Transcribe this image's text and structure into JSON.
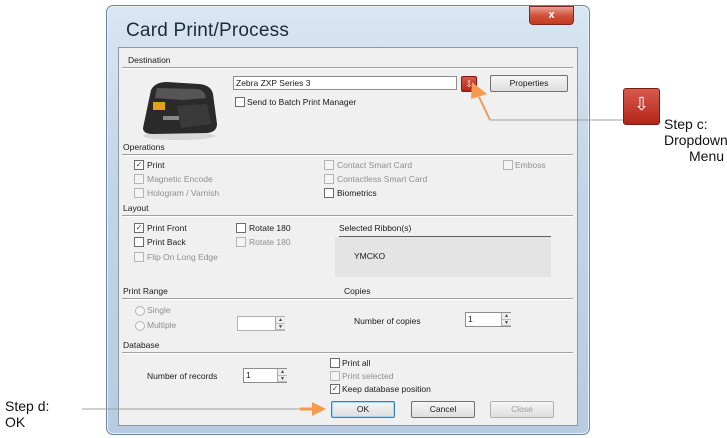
{
  "window": {
    "title": "Card Print/Process",
    "close_glyph": "x"
  },
  "destination": {
    "label": "Destination",
    "printer": "Zebra ZXP Series 3",
    "properties": "Properties",
    "batch": "Send to Batch Print Manager"
  },
  "operations": {
    "label": "Operations",
    "print": "Print",
    "magnetic": "Magnetic Encode",
    "hologram": "Hologram / Varnish",
    "contact": "Contact Smart Card",
    "contactless": "Contactless Smart Card",
    "biometrics": "Biometrics",
    "emboss": "Emboss"
  },
  "layout": {
    "label": "Layout",
    "front": "Print Front",
    "back": "Print Back",
    "flip": "Flip On Long Edge",
    "rotate1": "Rotate 180",
    "rotate2": "Rotate 180",
    "ribbon_header": "Selected Ribbon(s)",
    "ribbon": "YMCKO"
  },
  "range": {
    "label": "Print Range",
    "single": "Single",
    "multiple": "Multiple"
  },
  "copies": {
    "label": "Copies",
    "number_label": "Number of copies",
    "value": "1"
  },
  "database": {
    "label": "Database",
    "records_label": "Number of records",
    "records_value": "1",
    "print_all": "Print all",
    "print_selected": "Print selected",
    "keep": "Keep database position"
  },
  "buttons": {
    "ok": "OK",
    "cancel": "Cancel",
    "close": "Close"
  },
  "annotations": {
    "step_c": [
      "Step c:",
      "Dropdown",
      "Menu"
    ],
    "step_d": [
      "Step d:",
      "OK"
    ],
    "arrow_color": "#f39a50"
  },
  "check": "✓"
}
